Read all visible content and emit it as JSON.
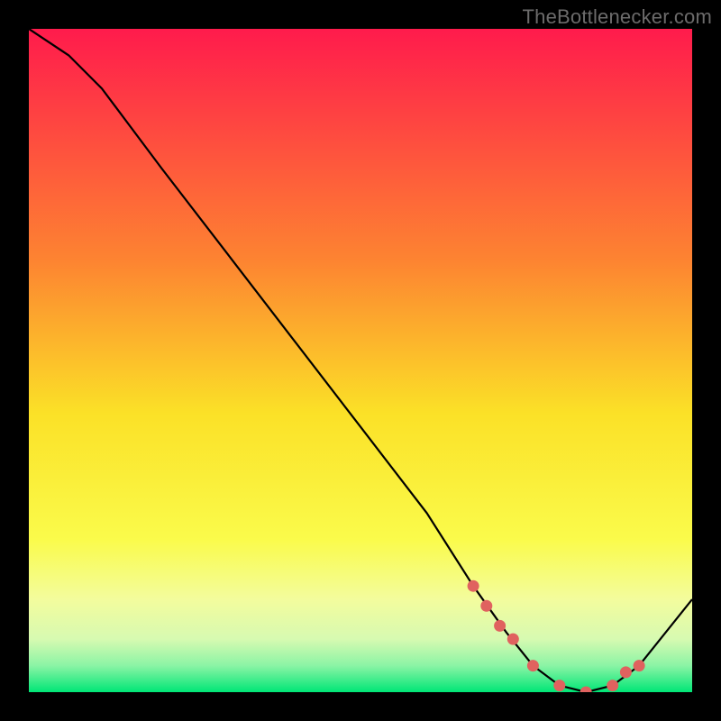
{
  "watermark": "TheBottlenecker.com",
  "chart_data": {
    "type": "line",
    "title": "",
    "xlabel": "",
    "ylabel": "",
    "xlim": [
      0,
      100
    ],
    "ylim": [
      0,
      100
    ],
    "grid": false,
    "background_gradient": {
      "stops": [
        {
          "offset": 0,
          "color": "#ff1b4c"
        },
        {
          "offset": 35,
          "color": "#fd8431"
        },
        {
          "offset": 58,
          "color": "#fbe127"
        },
        {
          "offset": 77,
          "color": "#fafb4b"
        },
        {
          "offset": 86,
          "color": "#f3fc9d"
        },
        {
          "offset": 92,
          "color": "#d7fab1"
        },
        {
          "offset": 96,
          "color": "#8bf4a5"
        },
        {
          "offset": 100,
          "color": "#00e676"
        }
      ]
    },
    "series": [
      {
        "name": "bottleneck-curve",
        "x": [
          0,
          6,
          11,
          20,
          30,
          40,
          50,
          60,
          67,
          72,
          76,
          80,
          84,
          88,
          92,
          100
        ],
        "y": [
          100,
          96,
          91,
          79,
          66,
          53,
          40,
          27,
          16,
          9,
          4,
          1,
          0,
          1,
          4,
          14
        ]
      }
    ],
    "markers": {
      "name": "highlight-points",
      "color": "#e0625f",
      "x": [
        67,
        69,
        71,
        73,
        76,
        80,
        84,
        88,
        90,
        92
      ],
      "y": [
        16,
        13,
        10,
        8,
        4,
        1,
        0,
        1,
        3,
        4
      ]
    }
  }
}
